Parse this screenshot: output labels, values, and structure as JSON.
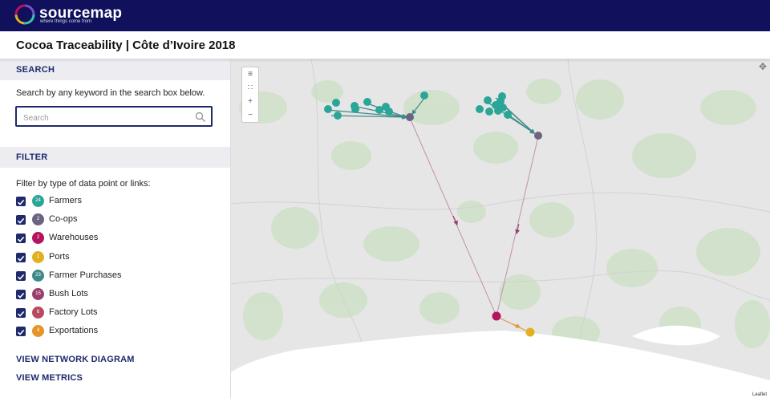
{
  "app": {
    "brand": "sourcemap",
    "tagline": "where things come from"
  },
  "page": {
    "title": "Cocoa Traceability | Côte d’Ivoire 2018"
  },
  "search": {
    "header": "SEARCH",
    "hint": "Search by any keyword in the search box below.",
    "placeholder": "Search",
    "value": ""
  },
  "filter": {
    "header": "FILTER",
    "hint": "Filter by type of data point or links:",
    "items": [
      {
        "label": "Farmers",
        "count": "24",
        "color": "#2aa698",
        "checked": true
      },
      {
        "label": "Co-ops",
        "count": "2",
        "color": "#6b6380",
        "checked": true
      },
      {
        "label": "Warehouses",
        "count": "2",
        "color": "#b5135f",
        "checked": true
      },
      {
        "label": "Ports",
        "count": "1",
        "color": "#e2b122",
        "checked": true
      },
      {
        "label": "Farmer Purchases",
        "count": "23",
        "color": "#3e8a8a",
        "checked": true
      },
      {
        "label": "Bush Lots",
        "count": "15",
        "color": "#9a3e6e",
        "checked": true
      },
      {
        "label": "Factory Lots",
        "count": "6",
        "color": "#b84a5e",
        "checked": true
      },
      {
        "label": "Exportations",
        "count": "4",
        "color": "#e59428",
        "checked": true
      }
    ]
  },
  "links": {
    "network": "VIEW NETWORK DIAGRAM",
    "metrics": "VIEW METRICS"
  },
  "map": {
    "zoom_buttons": [
      "≡",
      "∷",
      "+",
      "−"
    ],
    "expand_icon": "✥",
    "attribution": "Leaflet",
    "colors": {
      "farmer": "#2aa698",
      "coop": "#6b6380",
      "warehouse": "#b5135f",
      "port": "#e2b122",
      "purchase_link": "#3e8a8a",
      "bushlot_link": "#9a3e6e",
      "export_link": "#e59428",
      "land": "#e6e6e6",
      "forest": "#cfe1c9",
      "water": "#ffffff"
    }
  }
}
